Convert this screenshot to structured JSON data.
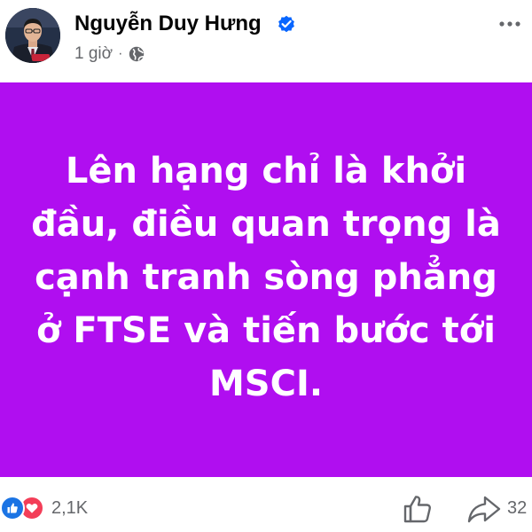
{
  "post": {
    "author": {
      "name": "Nguyễn Duy Hưng",
      "verified": true
    },
    "meta": {
      "time": "1 giờ",
      "separator": "·",
      "audience_icon": "globe-icon"
    },
    "card": {
      "background_color": "#b00ef0",
      "text_color": "#ffffff",
      "text": "Lên hạng chỉ là khởi đầu, điều quan trọng là cạnh tranh sòng phẳng ở FTSE và tiến bước tới MSCI."
    },
    "footer": {
      "reactions": {
        "icons": [
          "like-icon",
          "love-icon"
        ],
        "count": "2,1K"
      },
      "shares_count": "32"
    }
  },
  "icons": {
    "verified": "verified-badge-icon",
    "more": "more-options-icon",
    "like": "thumbs-up-icon",
    "share": "share-arrow-icon"
  },
  "colors": {
    "verified_blue": "#0866ff",
    "like_blue": "#1b74e4",
    "love_red": "#f33e58",
    "meta_gray": "#65676b"
  }
}
